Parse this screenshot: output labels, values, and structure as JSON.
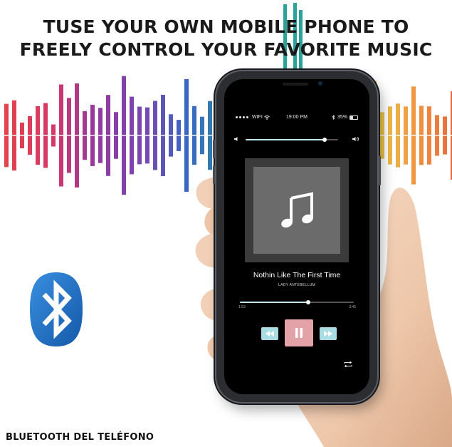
{
  "headline": {
    "line1": "TUSE YOUR OWN MOBILE PHONE TO",
    "line2": "FREELY CONTROL YOUR FAVORITE MUSIC"
  },
  "footer_text": "BLUETOOTH DEL TELÉFONO",
  "phone": {
    "status_bar": {
      "carrier": "WIFI",
      "time": "19:00 PM",
      "battery": "35%",
      "battery_level": 0.35
    },
    "volume_level": 0.85,
    "album_art_icon": "music-note-icon",
    "song_title": "Nothin Like The First Time",
    "artist": "LADY ANTEBELLUM",
    "elapsed": "1:53",
    "duration": "3:45",
    "progress": 0.6,
    "controls": [
      "rewind-icon",
      "pause-icon",
      "fast-forward-icon",
      "repeat-icon"
    ]
  },
  "colors": {
    "accent_teal": "#a9dde3",
    "pause_pink": "#e2a2a8",
    "bluetooth_blue": "#1f6fc4"
  }
}
